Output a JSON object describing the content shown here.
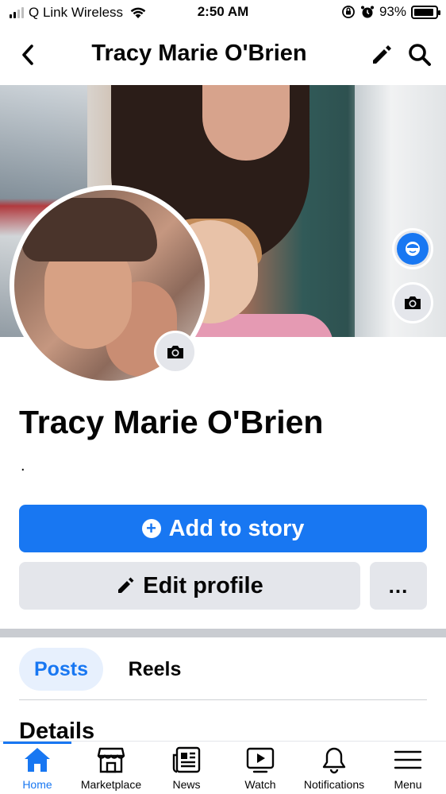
{
  "status_bar": {
    "carrier": "Q Link Wireless",
    "time": "2:50 AM",
    "battery_percent": "93%",
    "battery_level": 0.93,
    "icons": [
      "signal-icon",
      "wifi-icon",
      "orientation-lock-icon",
      "alarm-icon",
      "battery-icon"
    ]
  },
  "header": {
    "title": "Tracy Marie O'Brien",
    "icons": [
      "back-icon",
      "pencil-icon",
      "search-icon"
    ]
  },
  "cover": {
    "buttons": [
      "avatar-icon",
      "camera-icon"
    ]
  },
  "profile": {
    "name": "Tracy Marie O'Brien",
    "bio": "."
  },
  "actions": {
    "add_to_story": "Add to story",
    "edit_profile": "Edit profile",
    "more": "..."
  },
  "tabs": [
    {
      "label": "Posts",
      "active": true
    },
    {
      "label": "Reels",
      "active": false
    }
  ],
  "details": {
    "heading": "Details"
  },
  "bottom_nav": [
    {
      "label": "Home",
      "icon": "home-icon",
      "active": true
    },
    {
      "label": "Marketplace",
      "icon": "marketplace-icon",
      "active": false
    },
    {
      "label": "News",
      "icon": "news-icon",
      "active": false
    },
    {
      "label": "Watch",
      "icon": "watch-icon",
      "active": false
    },
    {
      "label": "Notifications",
      "icon": "bell-icon",
      "active": false
    },
    {
      "label": "Menu",
      "icon": "menu-icon",
      "active": false
    }
  ],
  "colors": {
    "accent": "#1877f2",
    "button_gray": "#e4e6eb",
    "text": "#050505",
    "active_tab_bg": "#e7f0fd"
  }
}
